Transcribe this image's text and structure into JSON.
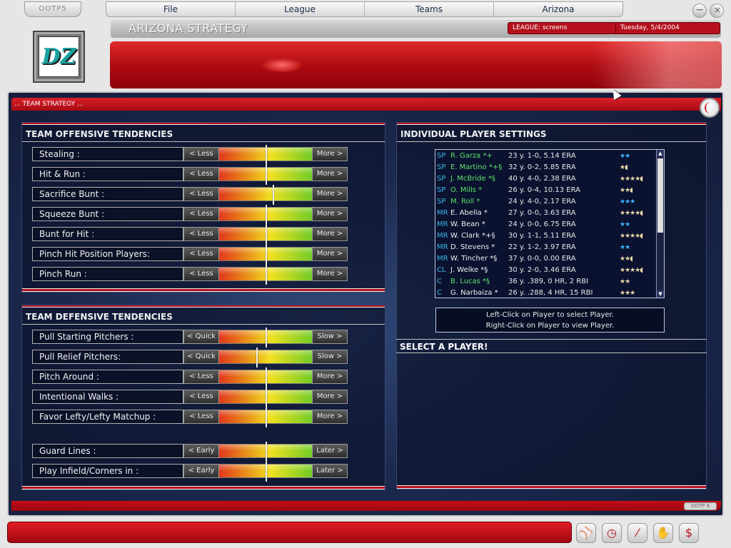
{
  "app": {
    "tab_label": "OOTP5",
    "logo_text": "DZ",
    "footer_label": "OOTP 6"
  },
  "menu": [
    {
      "label": "File"
    },
    {
      "label": "League"
    },
    {
      "label": "Teams"
    },
    {
      "label": "Arizona"
    }
  ],
  "window_buttons": {
    "minimize": "−",
    "close": "+"
  },
  "header": {
    "title": "ARIZONA STRATEGY",
    "league": "LEAGUE: screens",
    "date": "Tuesday, 5/4/2004"
  },
  "strategy_bar": {
    "label": "... TEAM STRATEGY ..."
  },
  "offense": {
    "title": "TEAM OFFENSIVE TENDENCIES",
    "rows": [
      {
        "label": "Stealing :",
        "left": "< Less",
        "right": "More >",
        "level": 0.5
      },
      {
        "label": "Hit & Run :",
        "left": "< Less",
        "right": "More >",
        "level": 0.5
      },
      {
        "label": "Sacrifice Bunt :",
        "left": "< Less",
        "right": "More >",
        "level": 0.58
      },
      {
        "label": "Squeeze Bunt :",
        "left": "< Less",
        "right": "More >",
        "level": 0.5
      },
      {
        "label": "Bunt for Hit :",
        "left": "< Less",
        "right": "More >",
        "level": 0.5
      },
      {
        "label": "Pinch Hit Position Players:",
        "left": "< Less",
        "right": "More >",
        "level": 0.5
      },
      {
        "label": "Pinch Run :",
        "left": "< Less",
        "right": "More >",
        "level": 0.5
      }
    ]
  },
  "defense": {
    "title": "TEAM DEFENSIVE TENDENCIES",
    "rows": [
      {
        "label": "Pull Starting Pitchers :",
        "left": "< Quick",
        "right": "Slow >",
        "level": 0.5
      },
      {
        "label": "Pull Relief Pitchers:",
        "left": "< Quick",
        "right": "Slow >",
        "level": 0.4
      },
      {
        "label": "Pitch Around :",
        "left": "< Less",
        "right": "More >",
        "level": 0.5
      },
      {
        "label": "Intentional Walks :",
        "left": "< Less",
        "right": "More >",
        "level": 0.5
      },
      {
        "label": "Favor Lefty/Lefty Matchup :",
        "left": "< Less",
        "right": "More >",
        "level": 0.5
      },
      {
        "label": "Guard Lines :",
        "left": "< Early",
        "right": "Later >",
        "level": 0.5
      },
      {
        "label": "Play Infield/Corners in :",
        "left": "< Early",
        "right": "Later >",
        "level": 0.5
      }
    ]
  },
  "players": {
    "title": "INDIVIDUAL PLAYER SETTINGS",
    "list": [
      {
        "pos": "SP",
        "name": "R. Garza *+",
        "stat": "23 y.  1-0, 5.14 ERA",
        "stars": "★★",
        "star_color": "#3ab4ff",
        "name_color": "green"
      },
      {
        "pos": "SP",
        "name": "E. Martino *+§",
        "stat": "32 y.  0-2, 5.85 ERA",
        "stars": "★◖",
        "star_color": "#e8d9a8",
        "name_color": "green"
      },
      {
        "pos": "SP",
        "name": "J. McBride *§",
        "stat": "40 y.  4-0, 2.38 ERA",
        "stars": "★★★★◖",
        "star_color": "#e8d9a8",
        "name_color": "green"
      },
      {
        "pos": "SP",
        "name": "O. Mills *",
        "stat": "26 y.  0-4, 10.13 ERA",
        "stars": "★★◖",
        "star_color": "#e8d9a8",
        "name_color": "green"
      },
      {
        "pos": "SP",
        "name": "M. Roll *",
        "stat": "24 y.  4-0, 2.17 ERA",
        "stars": "★★★",
        "star_color": "#3ab4ff",
        "name_color": "green"
      },
      {
        "pos": "MR",
        "name": "E. Abella *",
        "stat": "27 y.  0-0, 3.63 ERA",
        "stars": "★★★★◖",
        "star_color": "#e8d9a8",
        "name_color": "white"
      },
      {
        "pos": "MR",
        "name": "W. Bean *",
        "stat": "24 y.  0-0, 6.75 ERA",
        "stars": "★★",
        "star_color": "#3ab4ff",
        "name_color": "white"
      },
      {
        "pos": "MR",
        "name": "W. Clark *+§",
        "stat": "30 y.  1-1, 5.11 ERA",
        "stars": "★★★★◖",
        "star_color": "#e8d9a8",
        "name_color": "white"
      },
      {
        "pos": "MR",
        "name": "D. Stevens *",
        "stat": "22 y.  1-2, 3.97 ERA",
        "stars": "★★",
        "star_color": "#3ab4ff",
        "name_color": "white"
      },
      {
        "pos": "MR",
        "name": "W. Tincher *§",
        "stat": "37 y.  0-0, 0.00 ERA",
        "stars": "★★◖",
        "star_color": "#e8d9a8",
        "name_color": "white"
      },
      {
        "pos": "CL",
        "name": "J. Welke *§",
        "stat": "30 y.  2-0, 3.46 ERA",
        "stars": "★★★★◖",
        "star_color": "#e8d9a8",
        "name_color": "white"
      },
      {
        "pos": "C",
        "name": "B. Lucas *§",
        "stat": "36 y.  .389, 0 HR, 2 RBI",
        "stars": "★★",
        "star_color": "#e8d9a8",
        "name_color": "green"
      },
      {
        "pos": "C",
        "name": "G. Narbaiza *",
        "stat": "26 y.  .288, 4 HR, 15 RBI",
        "stars": "★★★",
        "star_color": "#e8d9a8",
        "name_color": "white"
      }
    ],
    "hint_line1": "Left-Click on Player to select Player.",
    "hint_line2": "Right-Click on Player to view Player.",
    "select_title": "SELECT A PLAYER!"
  },
  "toolbar": [
    {
      "name": "player-icon",
      "glyph": "⚾"
    },
    {
      "name": "schedule-icon",
      "glyph": "◷"
    },
    {
      "name": "bat-icon",
      "glyph": "⁄"
    },
    {
      "name": "glove-icon",
      "glyph": "✋"
    },
    {
      "name": "finance-icon",
      "glyph": "$"
    }
  ],
  "colors": {
    "accent_red": "#b5101c",
    "panel_bg": "#0c142c",
    "position_blue": "#39b7e4",
    "player_green": "#5fe36a"
  }
}
